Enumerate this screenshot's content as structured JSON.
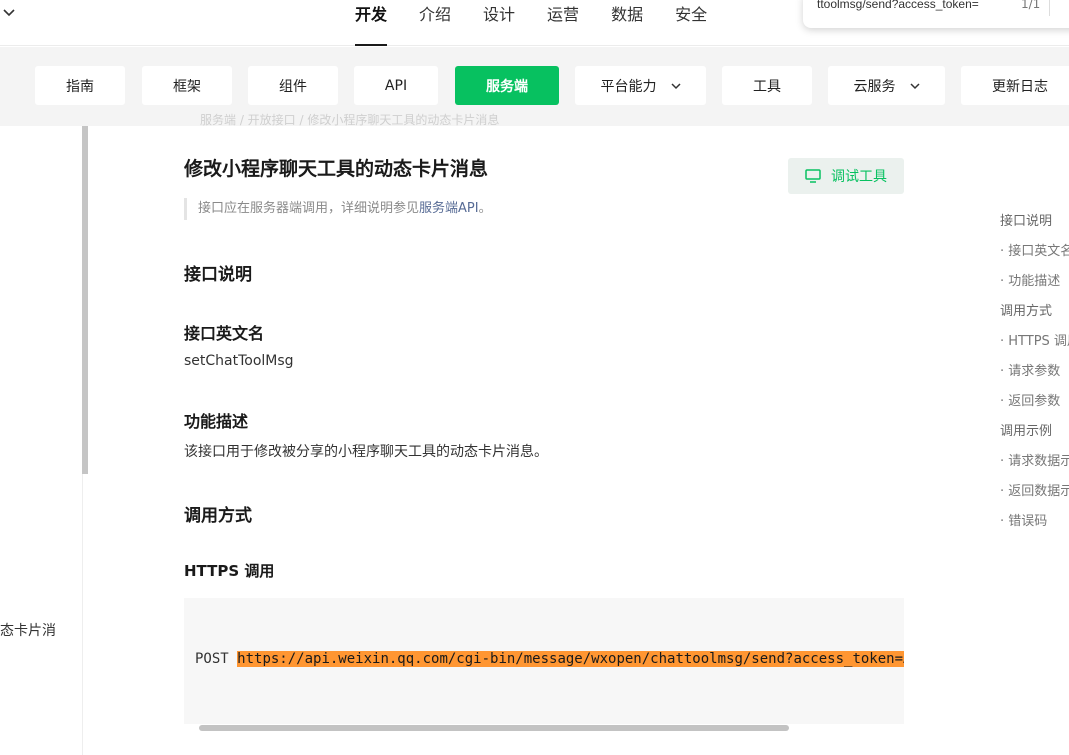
{
  "topnav": {
    "tabs": [
      {
        "label": "开发",
        "active": true
      },
      {
        "label": "介绍"
      },
      {
        "label": "设计"
      },
      {
        "label": "运营"
      },
      {
        "label": "数据"
      },
      {
        "label": "安全"
      }
    ]
  },
  "findbar": {
    "query": "ttoolmsg/send?access_token=",
    "count": "1/1"
  },
  "subnav": {
    "items": [
      "指南",
      "框架",
      "组件",
      "API",
      "服务端",
      "平台能力",
      "工具",
      "云服务",
      "更新日志"
    ],
    "active": "服务端"
  },
  "sidebar": {
    "item": "态卡片消"
  },
  "main": {
    "breadcrumb": "服务端 / 开放接口 / 修改小程序聊天工具的动态卡片消息",
    "title": "修改小程序聊天工具的动态卡片消息",
    "debug_button": "调试工具",
    "note_prefix": "接口应在服务器端调用，详细说明参见",
    "note_link": "服务端API",
    "note_suffix": "。",
    "section_api": "接口说明",
    "api_en_name_heading": "接口英文名",
    "api_en_name": "setChatToolMsg",
    "func_heading": "功能描述",
    "func_desc": "该接口用于修改被分享的小程序聊天工具的动态卡片消息。",
    "section_call": "调用方式",
    "https_heading": "HTTPS 调用",
    "code_method": "POST",
    "code_url": "https://api.weixin.qq.com/cgi-bin/message/wxopen/chattoolmsg/send?access_token=ACCESS_TOKEN"
  },
  "toc": {
    "items": [
      {
        "label": "接口说明",
        "level": 1
      },
      {
        "label": "· 接口英文名",
        "level": 2
      },
      {
        "label": "· 功能描述",
        "level": 2
      },
      {
        "label": "调用方式",
        "level": 1
      },
      {
        "label": "· HTTPS 调用",
        "level": 2
      },
      {
        "label": "· 请求参数",
        "level": 2
      },
      {
        "label": "· 返回参数",
        "level": 2
      },
      {
        "label": "调用示例",
        "level": 1
      },
      {
        "label": "· 请求数据示例",
        "level": 2
      },
      {
        "label": "· 返回数据示例",
        "level": 2
      },
      {
        "label": "· 错误码",
        "level": 2
      }
    ]
  },
  "colors": {
    "brand_green": "#07c160",
    "link": "#576b95",
    "search_highlight": "#ff9632"
  }
}
